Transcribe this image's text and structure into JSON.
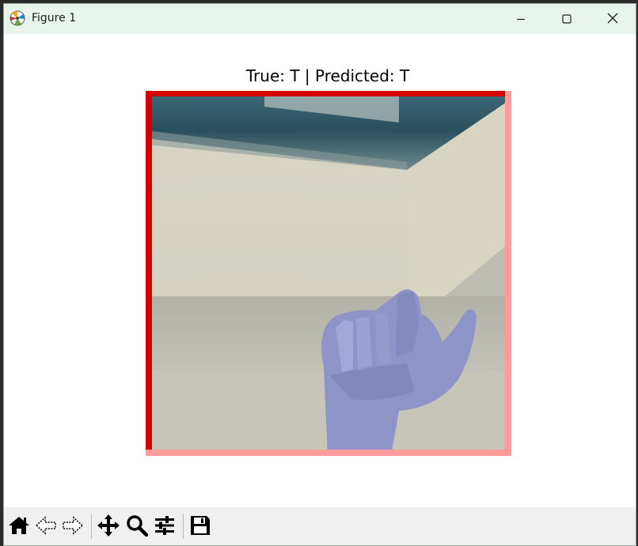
{
  "window": {
    "title": "Figure 1",
    "app_icon": "matplotlib-icon",
    "controls": {
      "minimize": "minimize-icon",
      "maximize": "maximize-icon",
      "close": "close-icon"
    }
  },
  "figure": {
    "title": "True: T | Predicted: T"
  },
  "toolbar": {
    "tools": [
      "home-icon",
      "back-icon",
      "forward-icon",
      "pan-icon",
      "zoom-icon",
      "configure-subplots-icon",
      "save-icon"
    ]
  },
  "colors": {
    "titlebar_bg": "#e9f4ec",
    "toolbar_bg": "#f0f0f0",
    "frame_red": "#d40000",
    "frame_pink": "#ff9b9b"
  }
}
